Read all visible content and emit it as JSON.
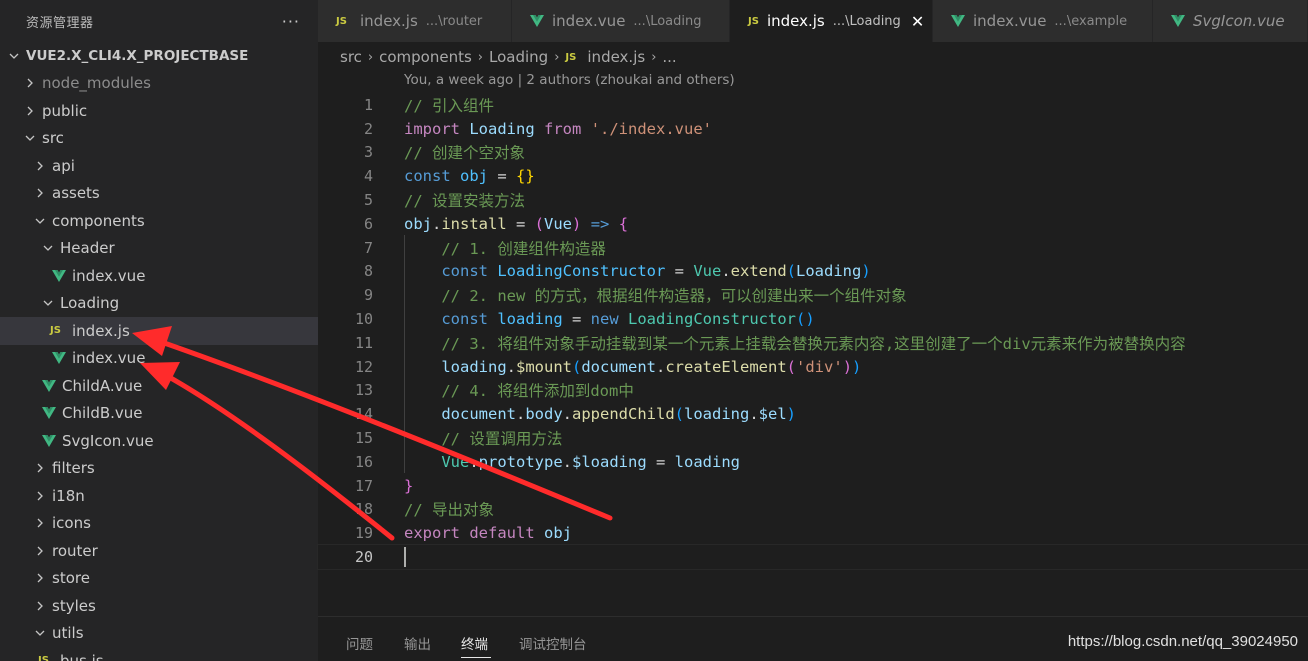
{
  "explorer": {
    "title": "资源管理器",
    "more": "···",
    "rows": [
      {
        "label": "VUE2.X_CLI4.X_PROJECTBASE",
        "kind": "project",
        "depth": 0,
        "chevron": "down"
      },
      {
        "label": "node_modules",
        "kind": "folder",
        "depth": 1,
        "chevron": "right",
        "dim": true
      },
      {
        "label": "public",
        "kind": "folder",
        "depth": 1,
        "chevron": "right"
      },
      {
        "label": "src",
        "kind": "folder",
        "depth": 1,
        "chevron": "down"
      },
      {
        "label": "api",
        "kind": "folder",
        "depth": 2,
        "chevron": "right"
      },
      {
        "label": "assets",
        "kind": "folder",
        "depth": 2,
        "chevron": "right"
      },
      {
        "label": "components",
        "kind": "folder",
        "depth": 2,
        "chevron": "down"
      },
      {
        "label": "Header",
        "kind": "folder",
        "depth": 3,
        "chevron": "down"
      },
      {
        "label": "index.vue",
        "kind": "vue",
        "depth": 4
      },
      {
        "label": "Loading",
        "kind": "folder",
        "depth": 3,
        "chevron": "down"
      },
      {
        "label": "index.js",
        "kind": "js",
        "depth": 4,
        "selected": true
      },
      {
        "label": "index.vue",
        "kind": "vue",
        "depth": 4
      },
      {
        "label": "ChildA.vue",
        "kind": "vue",
        "depth": 3
      },
      {
        "label": "ChildB.vue",
        "kind": "vue",
        "depth": 3
      },
      {
        "label": "SvgIcon.vue",
        "kind": "vue",
        "depth": 3
      },
      {
        "label": "filters",
        "kind": "folder",
        "depth": 2,
        "chevron": "right"
      },
      {
        "label": "i18n",
        "kind": "folder",
        "depth": 2,
        "chevron": "right"
      },
      {
        "label": "icons",
        "kind": "folder",
        "depth": 2,
        "chevron": "right"
      },
      {
        "label": "router",
        "kind": "folder",
        "depth": 2,
        "chevron": "right"
      },
      {
        "label": "store",
        "kind": "folder",
        "depth": 2,
        "chevron": "right"
      },
      {
        "label": "styles",
        "kind": "folder",
        "depth": 2,
        "chevron": "right"
      },
      {
        "label": "utils",
        "kind": "folder",
        "depth": 2,
        "chevron": "down"
      },
      {
        "label": "bus.js",
        "kind": "js",
        "depth": 3
      }
    ]
  },
  "tabs": [
    {
      "name": "index.js",
      "path": "...\\router",
      "kind": "js"
    },
    {
      "name": "index.vue",
      "path": "...\\Loading",
      "kind": "vue"
    },
    {
      "name": "index.js",
      "path": "...\\Loading",
      "kind": "js",
      "active": true,
      "close": "✕"
    },
    {
      "name": "index.vue",
      "path": "...\\example",
      "kind": "vue"
    },
    {
      "name": "SvgIcon.vue",
      "path": "",
      "kind": "vue",
      "italic": true
    }
  ],
  "breadcrumb": [
    "src",
    "components",
    "Loading",
    "index.js",
    "..."
  ],
  "blame": "You, a week ago | 2 authors (zhoukai and others)",
  "code": [
    [
      [
        "// 引入组件",
        "#6a9955"
      ]
    ],
    [
      [
        "import",
        "#c586c0"
      ],
      [
        " ",
        ""
      ],
      [
        "Loading",
        "#9cdcfe"
      ],
      [
        " ",
        ""
      ],
      [
        "from",
        "#c586c0"
      ],
      [
        " ",
        ""
      ],
      [
        "'./index.vue'",
        "#ce9178"
      ]
    ],
    [
      [
        "// 创建个空对象",
        "#6a9955"
      ]
    ],
    [
      [
        "const",
        "#569cd6"
      ],
      [
        " ",
        ""
      ],
      [
        "obj",
        "#4fc1ff"
      ],
      [
        " = ",
        "#d4d4d4"
      ],
      [
        "{}",
        "#ffd700"
      ]
    ],
    [
      [
        "// 设置安装方法",
        "#6a9955"
      ]
    ],
    [
      [
        "obj",
        "#9cdcfe"
      ],
      [
        ".",
        "#d4d4d4"
      ],
      [
        "install",
        "#dcdcaa"
      ],
      [
        " = ",
        "#d4d4d4"
      ],
      [
        "(",
        "#da70d6"
      ],
      [
        "Vue",
        "#9cdcfe"
      ],
      [
        ")",
        "#da70d6"
      ],
      [
        " ",
        ""
      ],
      [
        "=>",
        "#569cd6"
      ],
      [
        " ",
        ""
      ],
      [
        "{",
        "#da70d6"
      ]
    ],
    [
      [
        "    ",
        ""
      ],
      [
        "// 1. 创建组件构造器",
        "#6a9955"
      ]
    ],
    [
      [
        "    ",
        ""
      ],
      [
        "const",
        "#569cd6"
      ],
      [
        " ",
        ""
      ],
      [
        "LoadingConstructor",
        "#4fc1ff"
      ],
      [
        " = ",
        "#d4d4d4"
      ],
      [
        "Vue",
        "#4ec9b0"
      ],
      [
        ".",
        "#d4d4d4"
      ],
      [
        "extend",
        "#dcdcaa"
      ],
      [
        "(",
        "#179fff"
      ],
      [
        "Loading",
        "#9cdcfe"
      ],
      [
        ")",
        "#179fff"
      ]
    ],
    [
      [
        "    ",
        ""
      ],
      [
        "// 2. new 的方式，根据组件构造器，可以创建出来一个组件对象",
        "#6a9955"
      ]
    ],
    [
      [
        "    ",
        ""
      ],
      [
        "const",
        "#569cd6"
      ],
      [
        " ",
        ""
      ],
      [
        "loading",
        "#4fc1ff"
      ],
      [
        " = ",
        "#d4d4d4"
      ],
      [
        "new",
        "#569cd6"
      ],
      [
        " ",
        ""
      ],
      [
        "LoadingConstructor",
        "#4ec9b0"
      ],
      [
        "()",
        "#179fff"
      ]
    ],
    [
      [
        "    ",
        ""
      ],
      [
        "// 3. 将组件对象手动挂载到某一个元素上挂载会替换元素内容,这里创建了一个div元素来作为被替换内容",
        "#6a9955"
      ]
    ],
    [
      [
        "    ",
        ""
      ],
      [
        "loading",
        "#9cdcfe"
      ],
      [
        ".",
        "#d4d4d4"
      ],
      [
        "$mount",
        "#dcdcaa"
      ],
      [
        "(",
        "#179fff"
      ],
      [
        "document",
        "#9cdcfe"
      ],
      [
        ".",
        "#d4d4d4"
      ],
      [
        "createElement",
        "#dcdcaa"
      ],
      [
        "(",
        "#da70d6"
      ],
      [
        "'div'",
        "#ce9178"
      ],
      [
        ")",
        "#da70d6"
      ],
      [
        ")",
        "#179fff"
      ]
    ],
    [
      [
        "    ",
        ""
      ],
      [
        "// 4. 将组件添加到dom中",
        "#6a9955"
      ]
    ],
    [
      [
        "    ",
        ""
      ],
      [
        "document",
        "#9cdcfe"
      ],
      [
        ".",
        "#d4d4d4"
      ],
      [
        "body",
        "#9cdcfe"
      ],
      [
        ".",
        "#d4d4d4"
      ],
      [
        "appendChild",
        "#dcdcaa"
      ],
      [
        "(",
        "#179fff"
      ],
      [
        "loading",
        "#9cdcfe"
      ],
      [
        ".",
        "#d4d4d4"
      ],
      [
        "$el",
        "#9cdcfe"
      ],
      [
        ")",
        "#179fff"
      ]
    ],
    [
      [
        "    ",
        ""
      ],
      [
        "// 设置调用方法",
        "#6a9955"
      ]
    ],
    [
      [
        "    ",
        ""
      ],
      [
        "Vue",
        "#4ec9b0"
      ],
      [
        ".",
        "#d4d4d4"
      ],
      [
        "prototype",
        "#9cdcfe"
      ],
      [
        ".",
        "#d4d4d4"
      ],
      [
        "$loading",
        "#9cdcfe"
      ],
      [
        " = ",
        "#d4d4d4"
      ],
      [
        "loading",
        "#9cdcfe"
      ]
    ],
    [
      [
        "}",
        "#da70d6"
      ]
    ],
    [
      [
        "// 导出对象",
        "#6a9955"
      ]
    ],
    [
      [
        "export",
        "#c586c0"
      ],
      [
        " ",
        ""
      ],
      [
        "default",
        "#c586c0"
      ],
      [
        " ",
        ""
      ],
      [
        "obj",
        "#9cdcfe"
      ]
    ],
    []
  ],
  "current_line": 20,
  "panel": {
    "tabs": [
      "问题",
      "输出",
      "终端",
      "调试控制台"
    ],
    "active": 2,
    "watermark": "https://blog.csdn.net/qq_39024950"
  },
  "colors": {
    "accent_arrow": "#ff2b2b",
    "vue_green": "#41b883",
    "js_yellow": "#cbcb41"
  }
}
